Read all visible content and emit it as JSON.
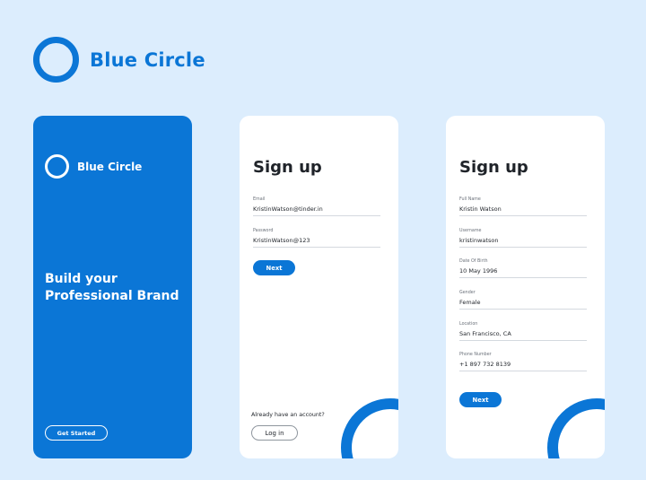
{
  "brand": {
    "name": "Blue Circle"
  },
  "welcome": {
    "brand_name": "Blue Circle",
    "headline": "Build your Professional Brand",
    "cta_label": "Get Started"
  },
  "signup_email": {
    "title": "Sign up",
    "fields": [
      {
        "label": "Email",
        "value": "KristinWatson@tinder.in"
      },
      {
        "label": "Password",
        "value": "KristinWatson@123"
      }
    ],
    "next_label": "Next",
    "account_prompt": "Already have an account?",
    "login_label": "Log in"
  },
  "signup_profile": {
    "title": "Sign up",
    "fields": [
      {
        "label": "Full Name",
        "value": "Kristin Watson"
      },
      {
        "label": "Username",
        "value": "kristinwatson"
      },
      {
        "label": "Date Of Birth",
        "value": "10 May 1996"
      },
      {
        "label": "Gender",
        "value": "Female"
      },
      {
        "label": "Location",
        "value": "San Francisco, CA"
      },
      {
        "label": "Phone Number",
        "value": "+1 897 732 8139"
      }
    ],
    "next_label": "Next"
  },
  "colors": {
    "brand_blue": "#0b76d6",
    "background": "#dcedfd",
    "text": "#1f2329"
  }
}
